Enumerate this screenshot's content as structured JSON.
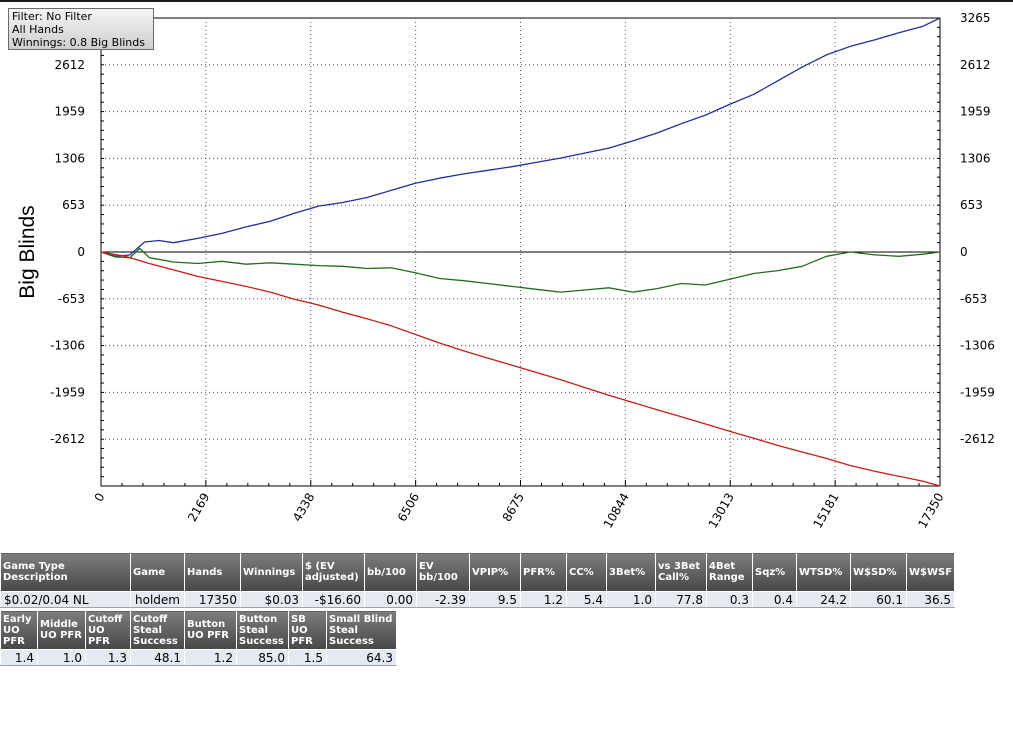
{
  "chart_data": {
    "type": "line",
    "ylabel": "Big Blinds",
    "xlim": [
      0,
      17350
    ],
    "ylim": [
      -3265,
      3265
    ],
    "x_ticks": [
      0,
      2169,
      4338,
      6506,
      8675,
      10844,
      13013,
      15181,
      17350
    ],
    "y_ticks": [
      -2612,
      -1959,
      -1306,
      -653,
      0,
      653,
      1306,
      1959,
      2612,
      3265
    ],
    "y_tick_labels": [
      "-2612",
      "-1959",
      "-1306",
      "-653",
      "0",
      "653",
      "1306",
      "1959",
      "2612",
      "3265"
    ],
    "grid": true,
    "series": [
      {
        "color": "#1f2f9e",
        "x": [
          0,
          300,
          600,
          900,
          1200,
          1500,
          2000,
          2500,
          3000,
          3500,
          4000,
          4500,
          5000,
          5500,
          6000,
          6500,
          7000,
          7500,
          8000,
          8500,
          9000,
          9500,
          10000,
          10500,
          11000,
          11500,
          12000,
          12500,
          13000,
          13500,
          14000,
          14500,
          15000,
          15500,
          16000,
          16500,
          17000,
          17350
        ],
        "y": [
          0,
          -60,
          -40,
          140,
          160,
          130,
          190,
          260,
          350,
          430,
          540,
          640,
          690,
          760,
          860,
          960,
          1030,
          1090,
          1140,
          1190,
          1250,
          1310,
          1380,
          1450,
          1550,
          1660,
          1790,
          1910,
          2060,
          2200,
          2390,
          2580,
          2750,
          2870,
          2960,
          3060,
          3150,
          3265
        ]
      },
      {
        "color": "#206e1a",
        "x": [
          0,
          300,
          600,
          800,
          1000,
          1500,
          2000,
          2500,
          3000,
          3500,
          4000,
          4500,
          5000,
          5500,
          6000,
          6500,
          7000,
          7500,
          8000,
          8500,
          9000,
          9500,
          10000,
          10500,
          11000,
          11500,
          12000,
          12500,
          13000,
          13500,
          14000,
          14500,
          15000,
          15500,
          16000,
          16500,
          17000,
          17350
        ],
        "y": [
          0,
          -70,
          -80,
          50,
          -80,
          -140,
          -160,
          -130,
          -170,
          -150,
          -170,
          -190,
          -200,
          -230,
          -220,
          -290,
          -370,
          -400,
          -440,
          -480,
          -520,
          -560,
          -530,
          -500,
          -560,
          -510,
          -440,
          -460,
          -380,
          -300,
          -260,
          -200,
          -60,
          0,
          -40,
          -60,
          -30,
          0
        ]
      },
      {
        "color": "#c21f14",
        "x": [
          0,
          500,
          1000,
          1500,
          2000,
          2500,
          3000,
          3500,
          4000,
          4500,
          5000,
          5500,
          6000,
          6500,
          7000,
          7500,
          8000,
          8500,
          9000,
          9500,
          10000,
          10500,
          11000,
          11500,
          12000,
          12500,
          13000,
          13500,
          14000,
          14500,
          15000,
          15500,
          16000,
          16500,
          17000,
          17350
        ],
        "y": [
          0,
          -60,
          -160,
          -250,
          -340,
          -410,
          -480,
          -560,
          -660,
          -740,
          -840,
          -930,
          -1030,
          -1150,
          -1270,
          -1380,
          -1480,
          -1580,
          -1680,
          -1780,
          -1890,
          -2000,
          -2100,
          -2200,
          -2300,
          -2400,
          -2500,
          -2600,
          -2700,
          -2790,
          -2880,
          -2980,
          -3060,
          -3130,
          -3200,
          -3265
        ]
      }
    ]
  },
  "filter_box": {
    "line1": "Filter: No Filter",
    "line2": "All Hands",
    "line3": "Winnings: 0.8 Big Blinds"
  },
  "stats_table_1": {
    "headers": [
      "Game Type Description",
      "Game",
      "Hands",
      "Winnings",
      "$ (EV adjusted)",
      "bb/100",
      "EV bb/100",
      "VPIP%",
      "PFR%",
      "CC%",
      "3Bet%",
      "vs 3Bet Call%",
      "4Bet Range",
      "Sqz%",
      "WTSD%",
      "W$SD%",
      "W$WSF"
    ],
    "row": [
      "$0.02/0.04 NL",
      "holdem",
      "17350",
      "$0.03",
      "-$16.60",
      "0.00",
      "-2.39",
      "9.5",
      "1.2",
      "5.4",
      "1.0",
      "77.8",
      "0.3",
      "0.4",
      "24.2",
      "60.1",
      "36.5"
    ]
  },
  "stats_table_2": {
    "headers": [
      "Early UO PFR",
      "Middle UO PFR",
      "Cutoff UO PFR",
      "Cutoff Steal Success",
      "Button UO PFR",
      "Button Steal Success",
      "SB UO PFR",
      "Small Blind Steal Success"
    ],
    "row": [
      "1.4",
      "1.0",
      "1.3",
      "48.1",
      "1.2",
      "85.0",
      "1.5",
      "64.3"
    ]
  }
}
